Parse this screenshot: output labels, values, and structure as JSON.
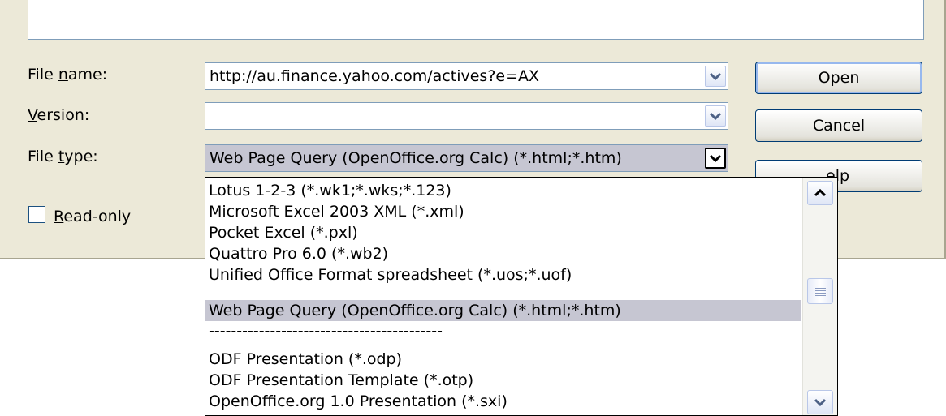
{
  "form": {
    "file_name": {
      "label_pre": "File ",
      "label_key": "n",
      "label_post": "ame:",
      "value": "http://au.finance.yahoo.com/actives?e=AX"
    },
    "version": {
      "label_pre": "",
      "label_key": "V",
      "label_post": "ersion:",
      "value": ""
    },
    "file_type": {
      "label_pre": "File ",
      "label_key": "t",
      "label_post": "ype:",
      "value": "Web Page Query (OpenOffice.org Calc) (*.html;*.htm)"
    },
    "read_only": {
      "label_key": "R",
      "label_post": "ead-only",
      "checked": false
    }
  },
  "buttons": {
    "open": {
      "key": "O",
      "rest": "pen"
    },
    "cancel": {
      "label": "Cancel"
    },
    "help": {
      "label_visible": "elp"
    }
  },
  "dropdown": {
    "options": [
      "Lotus 1-2-3 (*.wk1;*.wks;*.123)",
      "Microsoft Excel 2003 XML (*.xml)",
      "Pocket Excel (*.pxl)",
      "Quattro Pro 6.0 (*.wb2)",
      "Unified Office Format spreadsheet (*.uos;*.uof)",
      "Web Page Query (OpenOffice.org Calc) (*.html;*.htm)",
      "------------------------------------------",
      "",
      "ODF Presentation (*.odp)",
      "ODF Presentation Template (*.otp)",
      "OpenOffice.org 1.0 Presentation (*.sxi)"
    ],
    "selected_index": 5
  },
  "colors": {
    "dialog_bg": "#ece9d8",
    "selection": "#c6c6d2",
    "border": "#7f9db9"
  }
}
